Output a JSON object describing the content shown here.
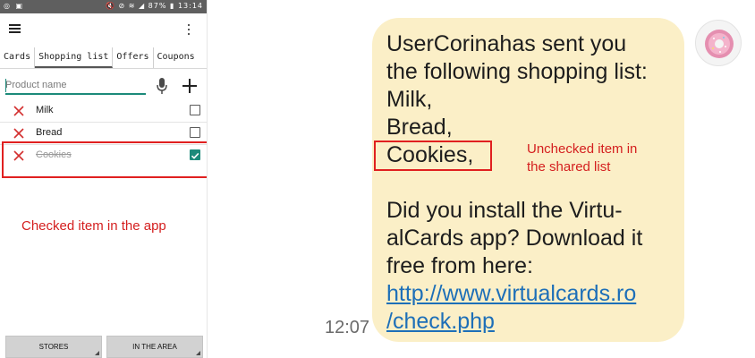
{
  "status_bar": {
    "left_icons": "◎ ▣",
    "right_text": "🔇 ⊘ ≋ ◢ 87% ▮ 13:14"
  },
  "app": {
    "menu_icon": "hamburger-menu-icon",
    "overflow_icon": "more-vertical-icon",
    "tabs": [
      {
        "label": "Cards"
      },
      {
        "label": "Shopping list"
      },
      {
        "label": "Offers"
      },
      {
        "label": "Coupons"
      }
    ],
    "active_tab": "Shopping list",
    "search": {
      "placeholder": "Product name",
      "value": ""
    },
    "items": [
      {
        "label": "Milk",
        "checked": false
      },
      {
        "label": "Bread",
        "checked": false
      },
      {
        "label": "Cookies",
        "checked": true
      }
    ],
    "bottom_buttons": [
      {
        "label": "STORES"
      },
      {
        "label": "IN THE AREA"
      }
    ],
    "accent_color": "#1c8a7a"
  },
  "annotations": {
    "app_note": "Checked item in the app",
    "message_note_line1": "Unchecked item in",
    "message_note_line2": "the shared list",
    "color": "#d41f1f"
  },
  "message": {
    "time": "12:07",
    "lines": [
      "UserCorinahas sent you",
      "the following shopping list:",
      "Milk,",
      "Bread,",
      "Cookies,",
      "",
      "Did you install the Virtu-",
      "alCards app? Download it",
      "free from here:"
    ],
    "link_line1": "http://www.virtualcards.ro",
    "link_line2": "/check.php",
    "bubble_color": "#fbefc7",
    "avatar_icon": "donut-avatar-icon"
  }
}
